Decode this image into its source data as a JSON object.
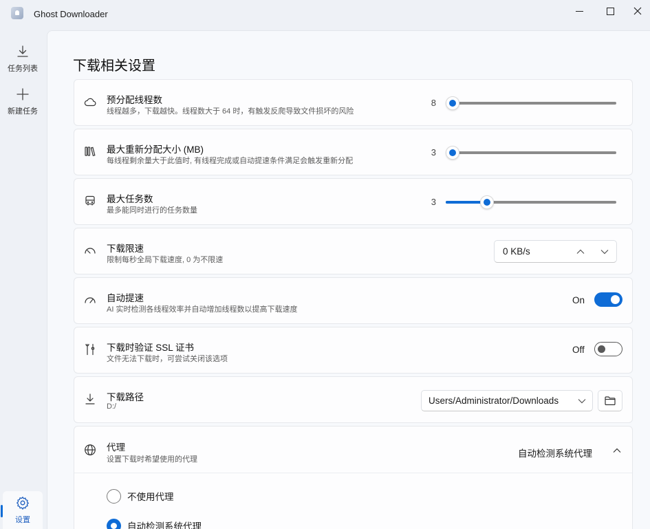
{
  "app": {
    "title": "Ghost Downloader"
  },
  "sidebar": {
    "items": [
      {
        "label": "任务列表"
      },
      {
        "label": "新建任务"
      },
      {
        "label": "设置"
      }
    ]
  },
  "page": {
    "title": "下载相关设置"
  },
  "settings": {
    "threads": {
      "title": "预分配线程数",
      "desc": "线程越多，下载越快。线程数大于 64 时，有触发反爬导致文件损坏的风险",
      "value": "8",
      "fraction": 0.0
    },
    "max_realloc": {
      "title": "最大重新分配大小 (MB)",
      "desc": "每线程剩余量大于此值时, 有线程完成或自动提速条件满足会触发重新分配",
      "value": "3",
      "fraction": 0.0
    },
    "max_tasks": {
      "title": "最大任务数",
      "desc": "最多能同时进行的任务数量",
      "value": "3",
      "fraction": 0.22
    },
    "speed_limit": {
      "title": "下载限速",
      "desc": "限制每秒全局下载速度, 0 为不限速",
      "value": "0 KB/s"
    },
    "auto_speedup": {
      "title": "自动提速",
      "desc": "AI 实时检测各线程效率并自动增加线程数以提高下载速度",
      "state": "On"
    },
    "ssl_verify": {
      "title": "下载时验证 SSL 证书",
      "desc": "文件无法下载时，可尝试关闭该选项",
      "state": "Off"
    },
    "download_path": {
      "title": "下载路径",
      "desc": "D:/",
      "value": "Users/Administrator/Downloads"
    },
    "proxy": {
      "title": "代理",
      "desc": "设置下载时希望使用的代理",
      "current": "自动检测系统代理",
      "options": [
        {
          "label": "不使用代理",
          "selected": false
        },
        {
          "label": "自动检测系统代理",
          "selected": true
        }
      ]
    }
  },
  "colors": {
    "accent": "#0f6cd6",
    "background": "#eef1f6",
    "card": "#fdfdfe"
  }
}
